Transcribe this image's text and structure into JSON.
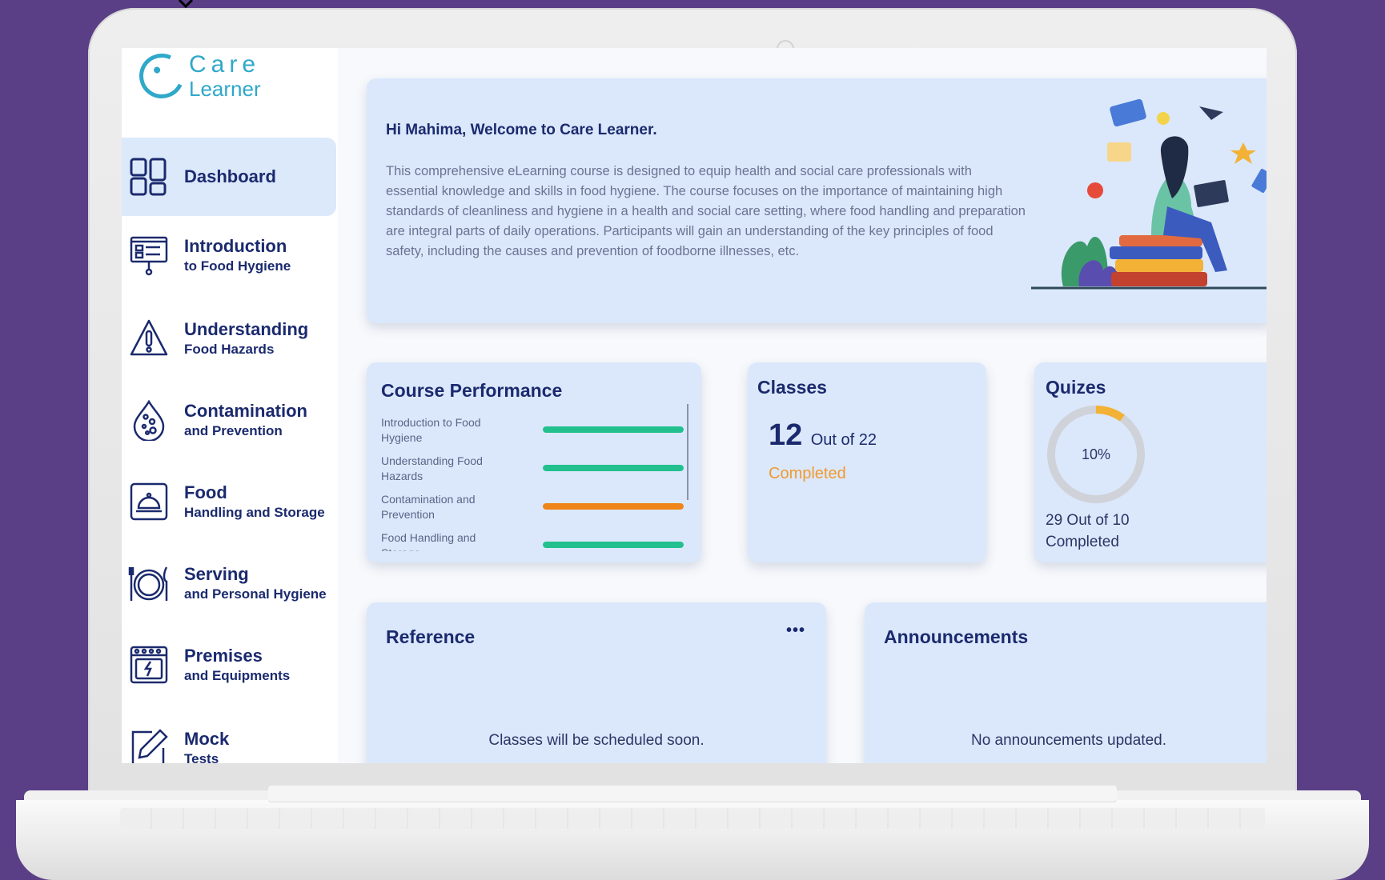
{
  "brand": {
    "line1": "Care",
    "line2": "Learner",
    "color": "#2fa8c9"
  },
  "sidebar": {
    "items": [
      {
        "main": "Dashboard",
        "sub": "",
        "icon": "dashboard-grid-icon",
        "active": true
      },
      {
        "main": "Introduction",
        "sub": "to Food Hygiene",
        "icon": "presentation-board-icon",
        "active": false
      },
      {
        "main": "Understanding",
        "sub": "Food Hazards",
        "icon": "warning-triangle-icon",
        "active": false
      },
      {
        "main": "Contamination",
        "sub": "and Prevention",
        "icon": "contamination-drop-icon",
        "active": false
      },
      {
        "main": "Food",
        "sub": "Handling and Storage",
        "icon": "cloche-icon",
        "active": false
      },
      {
        "main": "Serving",
        "sub": "and Personal Hygiene",
        "icon": "plate-cutlery-icon",
        "active": false
      },
      {
        "main": "Premises",
        "sub": "and Equipments",
        "icon": "oven-icon",
        "active": false
      },
      {
        "main": "Mock",
        "sub": "Tests",
        "icon": "pencil-edit-icon",
        "active": false
      }
    ]
  },
  "welcome": {
    "title": "Hi Mahima, Welcome to Care Learner.",
    "body": "This comprehensive eLearning course is designed to equip health and social care professionals with essential knowledge and skills in food hygiene. The course focuses on the importance of maintaining high standards of cleanliness and hygiene in a health and social care setting, where food handling and preparation are integral parts of daily operations. Participants will gain an understanding of the key principles of food safety, including the causes and prevention of foodborne illnesses, etc."
  },
  "performance": {
    "title": "Course Performance",
    "rows": [
      {
        "label": "Introduction to Food Hygiene",
        "progress": 1.0,
        "color": "#22c08e"
      },
      {
        "label": "Understanding Food Hazards",
        "progress": 1.0,
        "color": "#22c08e"
      },
      {
        "label": "Contamination and Prevention",
        "progress": 1.0,
        "color": "#ef8418"
      },
      {
        "label": "Food Handling and Storage",
        "progress": 1.0,
        "color": "#22c08e"
      }
    ]
  },
  "classes": {
    "title": "Classes",
    "count": "12",
    "out_of": "Out of 22",
    "status": "Completed"
  },
  "quiz": {
    "title": "Quizes",
    "percent_label": "10%",
    "percent": 0.1,
    "line1": "29 Out of 10",
    "line2": "Completed",
    "track_color": "#cfd2d8",
    "fill_color": "#f3b236"
  },
  "reference": {
    "title": "Reference",
    "menu": "•••",
    "message": "Classes will be scheduled soon."
  },
  "announcements": {
    "title": "Announcements",
    "message": "No announcements updated."
  }
}
